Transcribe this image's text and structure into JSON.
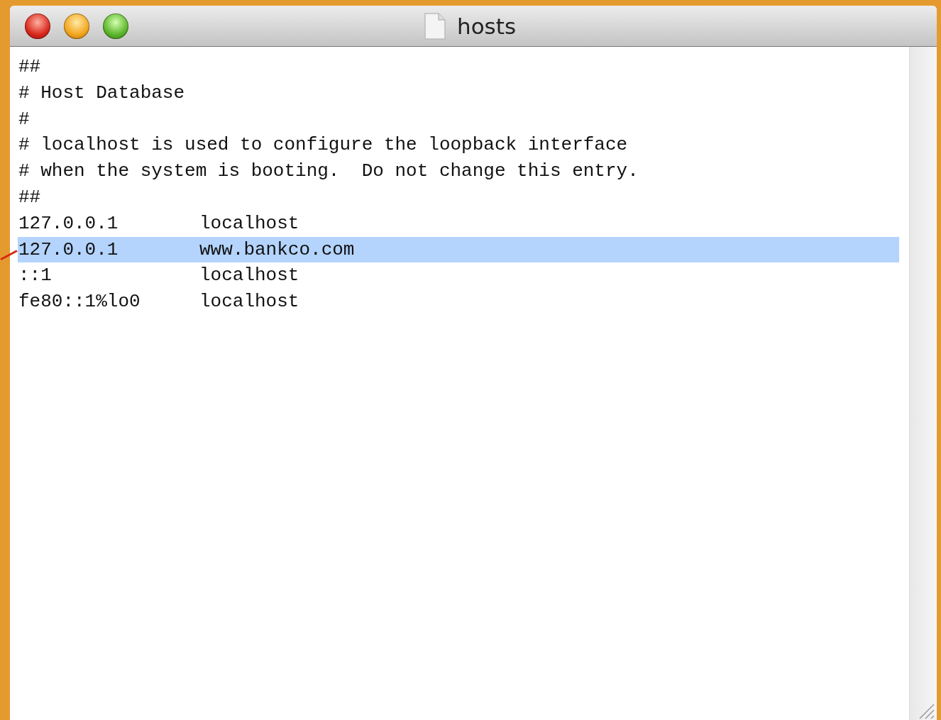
{
  "window": {
    "title": "hosts"
  },
  "lines": [
    {
      "kind": "comment",
      "text": "##",
      "selected": false
    },
    {
      "kind": "comment",
      "text": "# Host Database",
      "selected": false
    },
    {
      "kind": "comment",
      "text": "#",
      "selected": false
    },
    {
      "kind": "comment",
      "text": "# localhost is used to configure the loopback interface",
      "selected": false
    },
    {
      "kind": "comment",
      "text": "# when the system is booting.  Do not change this entry.",
      "selected": false
    },
    {
      "kind": "comment",
      "text": "##",
      "selected": false
    },
    {
      "kind": "entry",
      "address": "127.0.0.1",
      "hostname": "localhost",
      "selected": false
    },
    {
      "kind": "entry",
      "address": "127.0.0.1",
      "hostname": "www.bankco.com",
      "selected": true
    },
    {
      "kind": "entry",
      "address": "::1",
      "hostname": "localhost",
      "selected": false
    },
    {
      "kind": "entry",
      "address": "fe80::1%lo0",
      "hostname": "localhost",
      "selected": false
    }
  ]
}
